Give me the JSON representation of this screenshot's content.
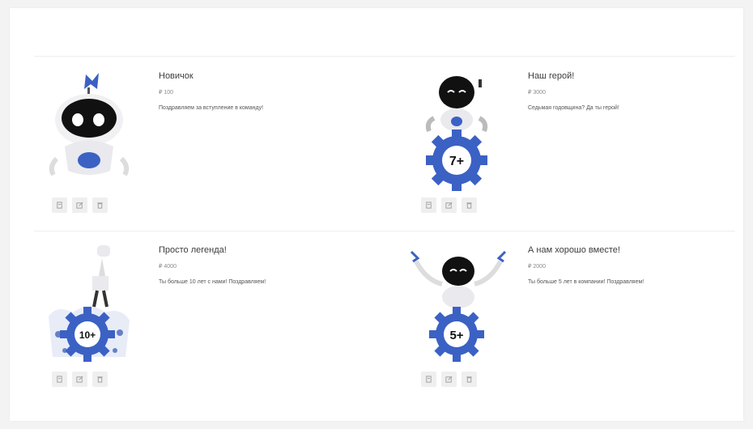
{
  "cards": [
    {
      "title": "Новичок",
      "points": "₽ 100",
      "description": "Поздравляем за вступление в команду!"
    },
    {
      "title": "Наш герой!",
      "points": "₽ 3000",
      "description": "Седьмая годовщина? Да ты герой!",
      "badge": "7+"
    },
    {
      "title": "Просто легенда!",
      "points": "₽ 4000",
      "description": "Ты больше 10 лет с нами! Поздравляем!",
      "badge": "10+"
    },
    {
      "title": "А нам хорошо вместе!",
      "points": "₽ 2000",
      "description": "Ты больше 5 лет в компании! Поздравляем!",
      "badge": "5+"
    }
  ],
  "icons": [
    "archive-icon",
    "edit-icon",
    "trash-icon"
  ],
  "colors": {
    "accent": "#3b61c4",
    "robot_face": "#111111"
  }
}
